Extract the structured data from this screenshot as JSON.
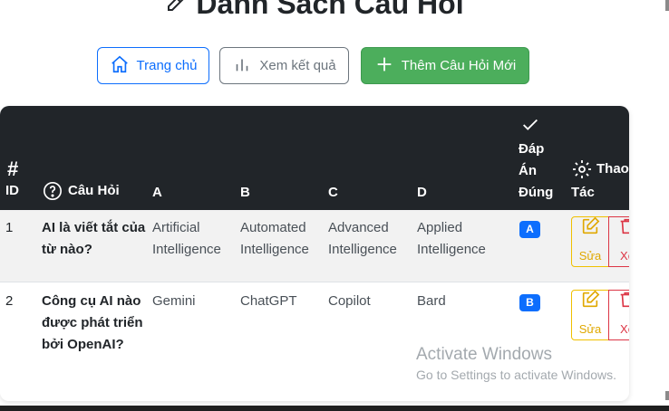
{
  "page": {
    "title": "Danh Sách Câu Hỏi"
  },
  "toolbar": {
    "home_label": "Trang chủ",
    "results_label": "Xem kết quả",
    "add_label": "Thêm Câu Hỏi Mới"
  },
  "table": {
    "headers": {
      "id_symbol": "#",
      "id": "ID",
      "question": "Câu Hỏi",
      "a": "A",
      "b": "B",
      "c": "C",
      "d": "D",
      "answer_1": "Đáp",
      "answer_2": "Án",
      "answer_3": "Đúng",
      "actions_1": "Thao",
      "actions_2": "Tác"
    },
    "rows": [
      {
        "id": "1",
        "question": "AI là viết tắt của từ nào?",
        "a": "Artificial Intelligence",
        "b": "Automated Intelligence",
        "c": "Advanced Intelligence",
        "d": "Applied Intelligence",
        "answer": "A",
        "edit_label": "Sửa",
        "delete_label": "Xó"
      },
      {
        "id": "2",
        "question": "Công cụ AI nào được phát triển bởi OpenAI?",
        "a": "Gemini",
        "b": "ChatGPT",
        "c": "Copilot",
        "d": "Bard",
        "answer": "B",
        "edit_label": "Sửa",
        "delete_label": "Xó"
      }
    ]
  },
  "watermark": {
    "line1": "Activate Windows",
    "line2": "Go to Settings to activate Windows."
  },
  "colors": {
    "primary": "#0d6efd",
    "success": "#4cae5c",
    "warning": "#f0c000",
    "danger": "#dc3545",
    "header_bg": "#212529"
  },
  "icons": [
    "pencil-icon",
    "house-icon",
    "bar-chart-icon",
    "plus-icon",
    "hash-icon",
    "question-circle-icon",
    "check-icon",
    "gear-icon",
    "edit-square-icon",
    "trash-icon"
  ]
}
